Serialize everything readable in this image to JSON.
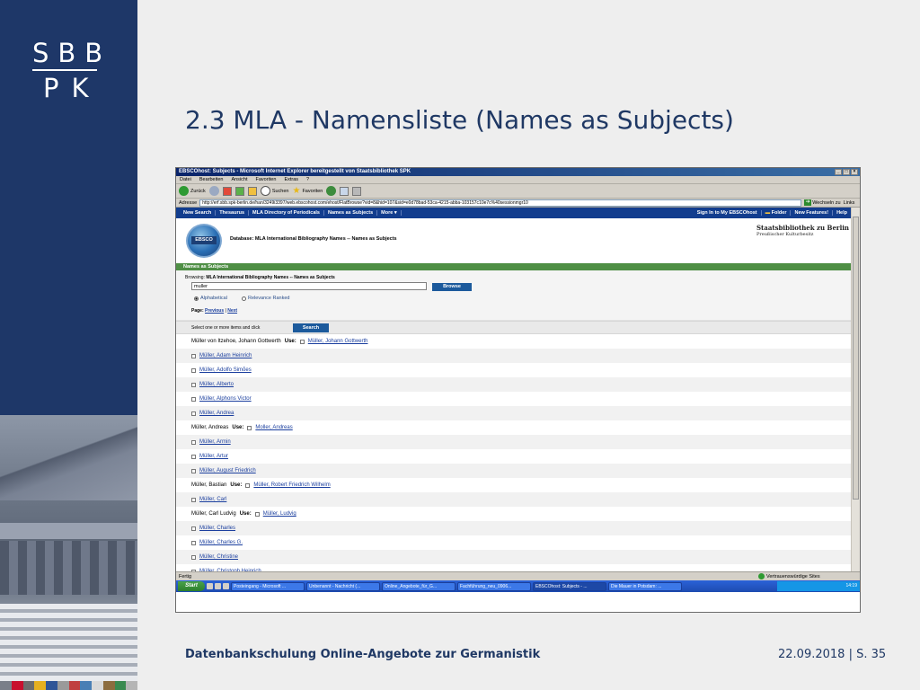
{
  "slide": {
    "logo_line1": "SBB",
    "logo_line2": "PK",
    "title": "2.3 MLA - Namensliste (Names as Subjects)",
    "footer_left": "Datenbankschulung Online-Angebote zur Germanistik",
    "footer_right": "22.09.2018 | S. 35",
    "strip_colors": [
      "#7a7f89",
      "#c8102e",
      "#6d6d6d",
      "#e6b020",
      "#2f5597",
      "#9a9a9a",
      "#c04040",
      "#4a7fb5",
      "#d9d9d9",
      "#8c6d3f",
      "#3a8a50",
      "#b5b5b5"
    ]
  },
  "browser": {
    "window_title": "EBSCOhost: Subjects - Microsoft Internet Explorer bereitgestellt von Staatsbibliothek SPK",
    "menu": [
      "Datei",
      "Bearbeiten",
      "Ansicht",
      "Favoriten",
      "Extras",
      "?"
    ],
    "toolbar": {
      "back": "Zurück",
      "search": "Suchen",
      "favorites": "Favoriten"
    },
    "address_label": "Adresse",
    "url": "http://erf.sbb.spk-berlin.de/han/3249i3397/web.ebscohost.com/ehost/FlatBrowse?vid=8&hid=107&sid=e0d78bad-53ca-4215-abba-103157c10e7c%40sessionmgr10",
    "go_label": "Wechseln zu",
    "links_label": "Links",
    "status_text": "Fertig",
    "trusted_zone": "Vertrauenswürdige Sites"
  },
  "ebsco": {
    "nav_left": [
      "New Search",
      "Thesaurus",
      "MLA Directory of Periodicals",
      "Names as Subjects",
      "More"
    ],
    "nav_right": [
      "Sign In to My EBSCOhost",
      "Folder",
      "New Features!",
      "Help"
    ],
    "logo_text": "EBSCO",
    "database_line": "Database: MLA International Bibliography Names -- Names as Subjects",
    "brand_line1": "Staatsbibliothek zu Berlin",
    "brand_line2": "Preußischer Kulturbesitz",
    "section_title": "Names as Subjects",
    "browsing_label": "Browsing:",
    "browsing_value": "MLA International Bibliography Names -- Names as Subjects",
    "search_term": "muller",
    "browse_button": "Browse",
    "radio_alpha": "Alphabetical",
    "radio_relevance": "Relevance Ranked",
    "page_label": "Page:",
    "page_prev": "Previous",
    "page_next": "Next",
    "select_text": "Select one or more items and click",
    "search_button": "Search",
    "use_label": "Use:",
    "results": [
      {
        "type": "see",
        "text": "Müller von Itzehoe, Johann Gottwerth",
        "target": "Müller, Johann Gottwerth"
      },
      {
        "type": "link",
        "text": "Müller, Adam Heinrich"
      },
      {
        "type": "link",
        "text": "Müller, Adolfo Simões"
      },
      {
        "type": "link",
        "text": "Müller, Alberto"
      },
      {
        "type": "link",
        "text": "Müller, Alphons Victor"
      },
      {
        "type": "link",
        "text": "Müller, Andrea"
      },
      {
        "type": "see",
        "text": "Müller, Andreas",
        "target": "Moller, Andreas"
      },
      {
        "type": "link",
        "text": "Müller, Armin"
      },
      {
        "type": "link",
        "text": "Müller, Artur"
      },
      {
        "type": "link",
        "text": "Müller, August Friedrich"
      },
      {
        "type": "see",
        "text": "Müller, Bastian",
        "target": "Müller, Robert Friedrich Wilhelm"
      },
      {
        "type": "link",
        "text": "Müller, Carl"
      },
      {
        "type": "see",
        "text": "Müller, Carl Ludvig",
        "target": "Müller, Ludvig"
      },
      {
        "type": "link",
        "text": "Müller, Charles"
      },
      {
        "type": "link",
        "text": "Müller, Charles G."
      },
      {
        "type": "link",
        "text": "Müller, Christine"
      },
      {
        "type": "link",
        "text": "Müller, Christoph Heinrich"
      }
    ]
  },
  "taskbar": {
    "start": "Start",
    "tasks": [
      "Posteingang - Microsoft ...",
      "Unbenannt - Nachricht (...",
      "Online_Angebote_für_G...",
      "Fachführung_neu_0906...",
      "EBSCOhost: Subjects - ...",
      "Die Mauer in Potsdam: ..."
    ],
    "clock": "14:19"
  }
}
